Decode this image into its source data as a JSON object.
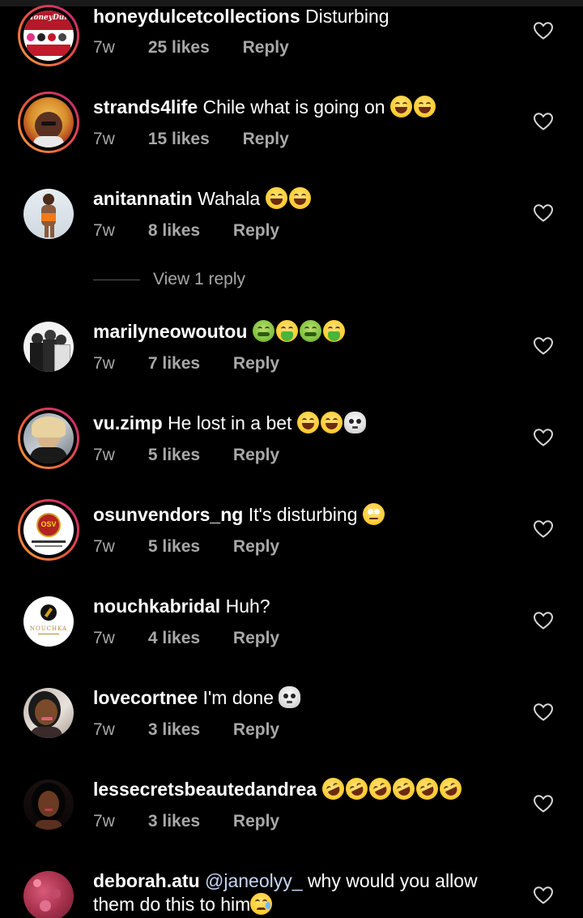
{
  "colors": {
    "background": "#000000",
    "text_primary": "#ffffff",
    "text_secondary": "#a8a8a8",
    "story_ring_start": "#f9a23c",
    "story_ring_end": "#c41f78",
    "mention": "#c7d4f5"
  },
  "comments": [
    {
      "username": "honeydulcetcollections",
      "text": "Disturbing",
      "emojis": [],
      "time": "7w",
      "likes": "25 likes",
      "reply": "Reply",
      "avatar_ring": "story",
      "avatar_logo_text": "HoneyDulcet"
    },
    {
      "username": "strands4life",
      "text": "Chile what is going on",
      "emojis": [
        "laugh",
        "laugh"
      ],
      "time": "7w",
      "likes": "15 likes",
      "reply": "Reply",
      "avatar_ring": "story"
    },
    {
      "username": "anitannatin",
      "text": "Wahala",
      "emojis": [
        "laugh",
        "laugh"
      ],
      "time": "7w",
      "likes": "8 likes",
      "reply": "Reply",
      "avatar_ring": "none",
      "view_replies": "View 1 reply"
    },
    {
      "username": "marilyneowoutou",
      "text": "",
      "emojis": [
        "nausea",
        "vomit",
        "nausea",
        "vomit"
      ],
      "time": "7w",
      "likes": "7 likes",
      "reply": "Reply",
      "avatar_ring": "none"
    },
    {
      "username": "vu.zimp",
      "text": "He lost in a bet",
      "emojis": [
        "laugh",
        "laugh",
        "skull"
      ],
      "time": "7w",
      "likes": "5 likes",
      "reply": "Reply",
      "avatar_ring": "story"
    },
    {
      "username": "osunvendors_ng",
      "text": "It's disturbing",
      "emojis": [
        "roll"
      ],
      "time": "7w",
      "likes": "5 likes",
      "reply": "Reply",
      "avatar_ring": "story",
      "avatar_logo_text": "OSV"
    },
    {
      "username": "nouchkabridal",
      "text": "Huh?",
      "emojis": [],
      "time": "7w",
      "likes": "4 likes",
      "reply": "Reply",
      "avatar_ring": "none",
      "avatar_logo_text": "NOUCHKA"
    },
    {
      "username": "lovecortnee",
      "text": "I'm done",
      "emojis": [
        "skull"
      ],
      "time": "7w",
      "likes": "3 likes",
      "reply": "Reply",
      "avatar_ring": "none"
    },
    {
      "username": "lessecretsbeautedandrea",
      "text": "",
      "emojis": [
        "rofl",
        "rofl",
        "rofl",
        "rofl",
        "rofl",
        "rofl"
      ],
      "time": "7w",
      "likes": "3 likes",
      "reply": "Reply",
      "avatar_ring": "none"
    },
    {
      "username": "deborah.atu",
      "mention": "@janeolyy_",
      "text": "why would you allow them do this to him",
      "emojis": [
        "sad"
      ],
      "avatar_ring": "none"
    }
  ]
}
